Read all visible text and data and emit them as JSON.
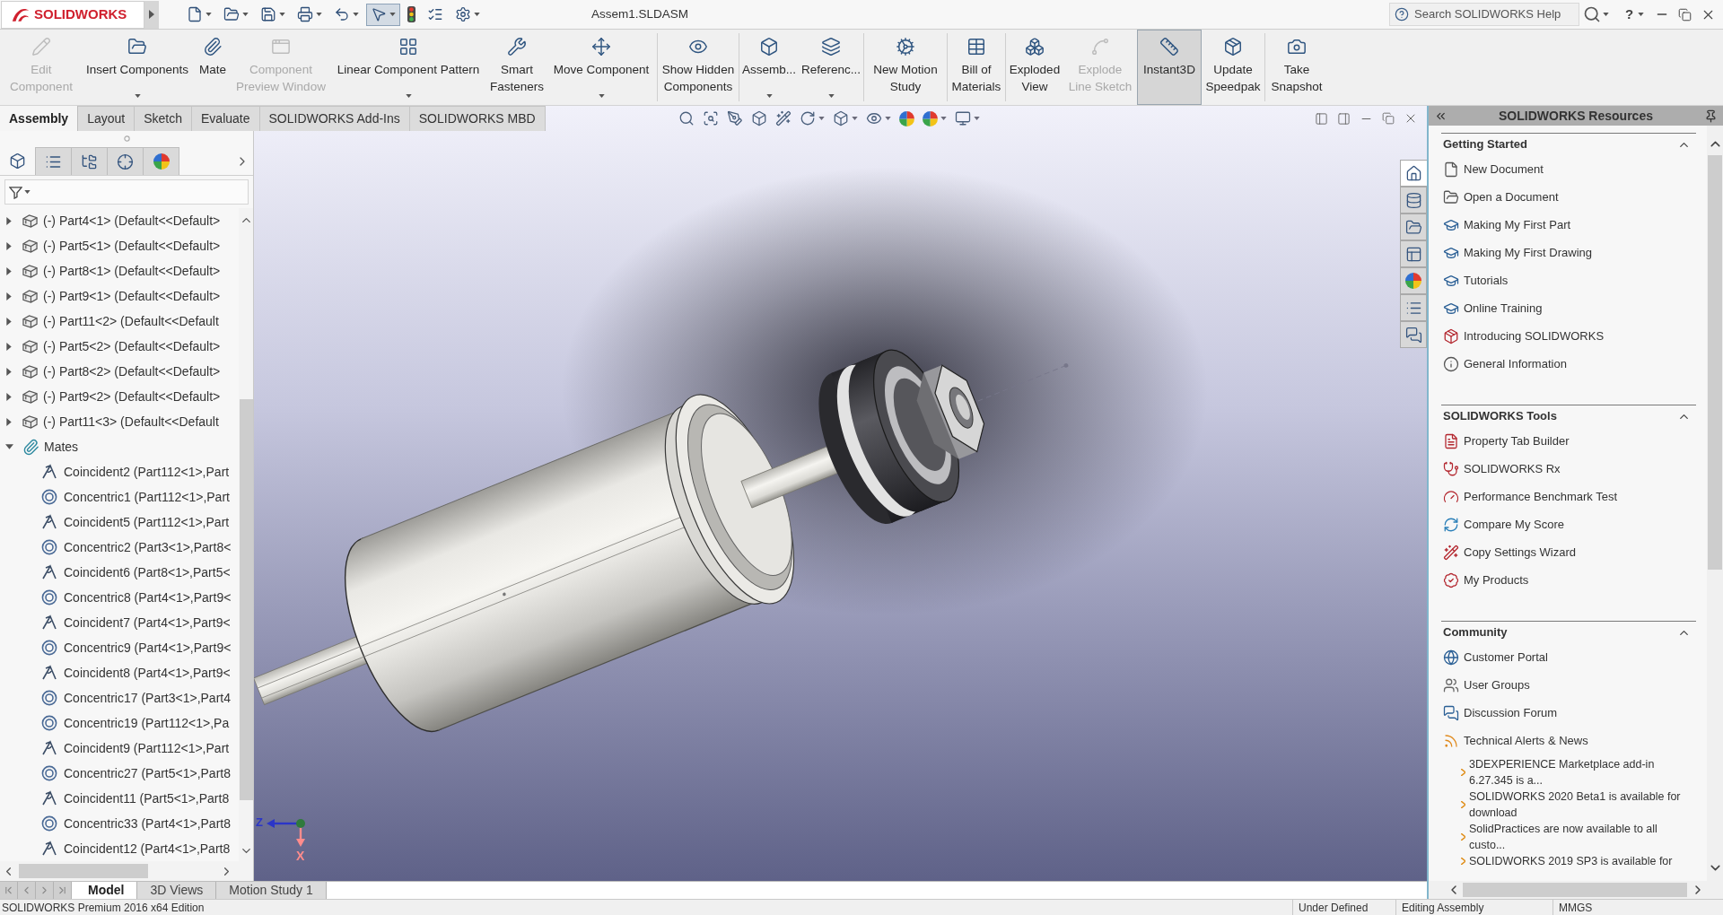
{
  "logo": {
    "text": "SOLIDWORKS"
  },
  "quick_access": [
    {
      "on": false
    },
    {
      "on": false
    },
    {
      "on": false
    },
    {
      "on": false
    },
    {
      "on": false
    },
    {
      "on": true
    },
    {
      "on": false
    },
    {
      "on": false
    },
    {
      "on": false
    }
  ],
  "window": {
    "title": "Assem1.SLDASM"
  },
  "help_search": {
    "placeholder": "Search SOLIDWORKS Help"
  },
  "help_menu": {
    "label": "?"
  },
  "command_manager": {
    "groups": [
      [
        {
          "label": "Edit Component",
          "disabled": true,
          "dropdown": false,
          "on": false
        },
        {
          "label": "Insert Components",
          "disabled": false,
          "dropdown": true,
          "on": false
        },
        {
          "label": "Mate",
          "disabled": false,
          "dropdown": false,
          "on": false
        },
        {
          "label": "Component Preview Window",
          "disabled": true,
          "dropdown": false,
          "on": false
        },
        {
          "label": "Linear Component Pattern",
          "disabled": false,
          "dropdown": true,
          "on": false
        },
        {
          "label": "Smart Fasteners",
          "disabled": false,
          "dropdown": false,
          "on": false
        },
        {
          "label": "Move Component",
          "disabled": false,
          "dropdown": true,
          "on": false
        }
      ],
      [
        {
          "label": "Show Hidden Components",
          "disabled": false,
          "dropdown": false,
          "on": false
        }
      ],
      [
        {
          "label": "Assemb...",
          "disabled": false,
          "dropdown": true,
          "on": false
        },
        {
          "label": "Referenc...",
          "disabled": false,
          "dropdown": true,
          "on": false
        }
      ],
      [
        {
          "label": "New Motion Study",
          "disabled": false,
          "dropdown": false,
          "on": false
        }
      ],
      [
        {
          "label": "Bill of Materials",
          "disabled": false,
          "dropdown": false,
          "on": false
        }
      ],
      [
        {
          "label": "Exploded View",
          "disabled": false,
          "dropdown": false,
          "on": false
        },
        {
          "label": "Explode Line Sketch",
          "disabled": true,
          "dropdown": false,
          "on": false
        },
        {
          "label": "Instant3D",
          "disabled": false,
          "dropdown": false,
          "on": true
        },
        {
          "label": "Update Speedpak",
          "disabled": false,
          "dropdown": false,
          "on": false
        }
      ],
      [
        {
          "label": "Take Snapshot",
          "disabled": false,
          "dropdown": false,
          "on": false
        }
      ]
    ]
  },
  "command_tabs": [
    {
      "label": "Assembly",
      "selected": true
    },
    {
      "label": "Layout",
      "selected": false
    },
    {
      "label": "Sketch",
      "selected": false
    },
    {
      "label": "Evaluate",
      "selected": false
    },
    {
      "label": "SOLIDWORKS Add-Ins",
      "selected": false
    },
    {
      "label": "SOLIDWORKS MBD",
      "selected": false
    }
  ],
  "manager_tabs": [
    {
      "selected": true
    },
    {
      "selected": false
    },
    {
      "selected": false
    },
    {
      "selected": false
    },
    {
      "selected": false
    }
  ],
  "feature_tree": [
    {
      "label": "(-) Part4<1> (Default<<Default>",
      "kind": "part",
      "expanded": false
    },
    {
      "label": "(-) Part5<1> (Default<<Default>",
      "kind": "part",
      "expanded": false
    },
    {
      "label": "(-) Part8<1> (Default<<Default>",
      "kind": "part",
      "expanded": false
    },
    {
      "label": "(-) Part9<1> (Default<<Default>",
      "kind": "part",
      "expanded": false
    },
    {
      "label": "(-) Part11<2> (Default<<Default",
      "kind": "part",
      "expanded": false
    },
    {
      "label": "(-) Part5<2> (Default<<Default>",
      "kind": "part",
      "expanded": false
    },
    {
      "label": "(-) Part8<2> (Default<<Default>",
      "kind": "part",
      "expanded": false
    },
    {
      "label": "(-) Part9<2> (Default<<Default>",
      "kind": "part",
      "expanded": false
    },
    {
      "label": "(-) Part11<3> (Default<<Default",
      "kind": "part",
      "expanded": false
    },
    {
      "label": "Mates",
      "kind": "mates",
      "expanded": true,
      "children": [
        {
          "label": "Coincident2 (Part112<1>,Part",
          "kind": "coincident"
        },
        {
          "label": "Concentric1 (Part112<1>,Part",
          "kind": "concentric"
        },
        {
          "label": "Coincident5 (Part112<1>,Part",
          "kind": "coincident"
        },
        {
          "label": "Concentric2 (Part3<1>,Part8<",
          "kind": "concentric"
        },
        {
          "label": "Coincident6 (Part8<1>,Part5<",
          "kind": "coincident"
        },
        {
          "label": "Concentric8 (Part4<1>,Part9<",
          "kind": "concentric"
        },
        {
          "label": "Coincident7 (Part4<1>,Part9<",
          "kind": "coincident"
        },
        {
          "label": "Concentric9 (Part4<1>,Part9<",
          "kind": "concentric"
        },
        {
          "label": "Coincident8 (Part4<1>,Part9<",
          "kind": "coincident"
        },
        {
          "label": "Concentric17 (Part3<1>,Part4",
          "kind": "concentric"
        },
        {
          "label": "Concentric19 (Part112<1>,Pa",
          "kind": "concentric"
        },
        {
          "label": "Coincident9 (Part112<1>,Part",
          "kind": "coincident"
        },
        {
          "label": "Concentric27 (Part5<1>,Part8",
          "kind": "concentric"
        },
        {
          "label": "Coincident11 (Part5<1>,Part8",
          "kind": "coincident"
        },
        {
          "label": "Concentric33 (Part4<1>,Part8",
          "kind": "concentric"
        },
        {
          "label": "Coincident12 (Part4<1>,Part8",
          "kind": "coincident"
        }
      ]
    }
  ],
  "triad": {
    "axes": [
      {
        "label": "Z",
        "color": "#2b35c8"
      },
      {
        "label": "X",
        "color": "#ff8c8c"
      }
    ]
  },
  "task_pane_tabs": [
    {
      "selected": true
    },
    {
      "selected": false
    },
    {
      "selected": false
    },
    {
      "selected": false
    },
    {
      "selected": false
    },
    {
      "selected": false
    },
    {
      "selected": false
    }
  ],
  "task_pane": {
    "title": "SOLIDWORKS Resources",
    "sections": [
      {
        "title": "Getting Started",
        "expanded": true,
        "items": [
          "New Document",
          "Open a Document",
          "Making My First Part",
          "Making My First Drawing",
          "Tutorials",
          "Online Training",
          "Introducing SOLIDWORKS",
          "General Information"
        ]
      },
      {
        "title": "SOLIDWORKS Tools",
        "expanded": true,
        "items": [
          "Property Tab Builder",
          "SOLIDWORKS Rx",
          "Performance Benchmark Test",
          "Compare My Score",
          "Copy Settings Wizard",
          "My Products"
        ]
      },
      {
        "title": "Community",
        "expanded": true,
        "items": [
          "Customer Portal",
          "User Groups",
          "Discussion Forum",
          "Technical Alerts & News"
        ],
        "news": [
          "3DEXPERIENCE Marketplace add-in 6.27.345 is a...",
          "SOLIDWORKS 2020 Beta1 is available for download",
          "SolidPractices are now available to all custo...",
          "SOLIDWORKS 2019 SP3 is available for"
        ]
      }
    ]
  },
  "model_tabs": [
    {
      "label": "Model",
      "selected": true
    },
    {
      "label": "3D Views",
      "selected": false
    },
    {
      "label": "Motion Study 1",
      "selected": false
    }
  ],
  "status_bar": {
    "edition": "SOLIDWORKS Premium 2016 x64 Edition",
    "fields": [
      "Under Defined",
      "Editing Assembly",
      "MMGS"
    ]
  }
}
